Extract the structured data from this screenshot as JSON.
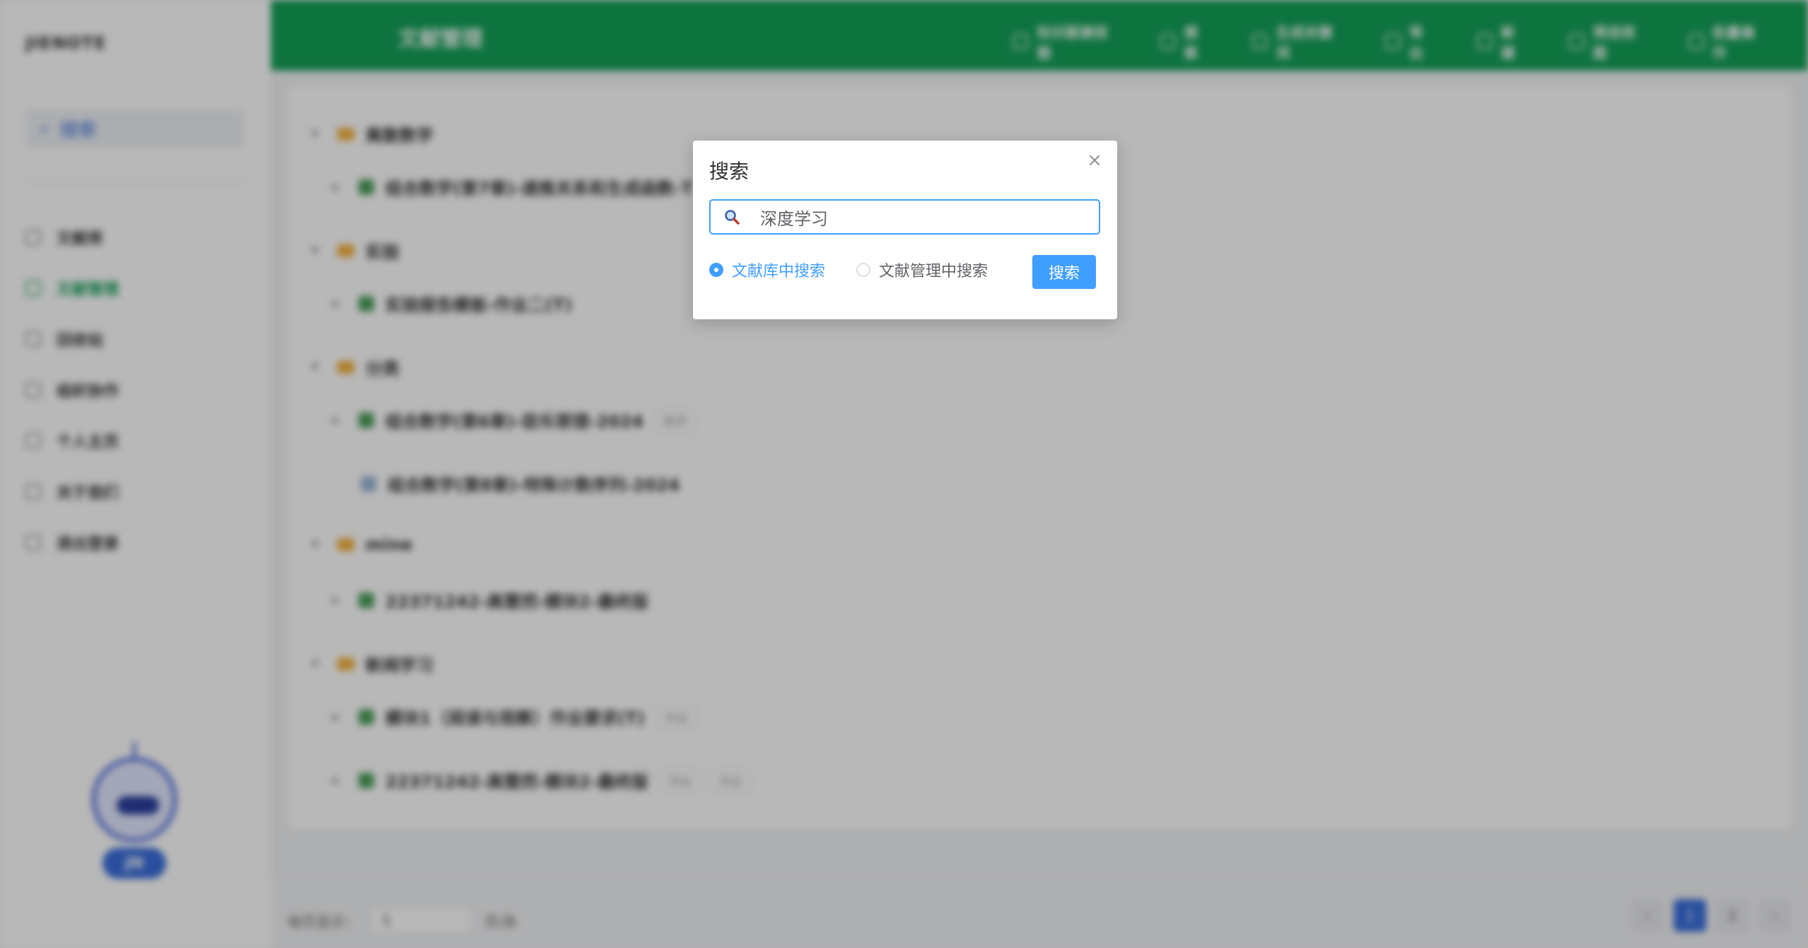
{
  "app": {
    "logo": "JIENOTE",
    "page_title": "文献管理"
  },
  "sidebar": {
    "search_label": "搜索",
    "items": [
      {
        "label": "文献库",
        "active": false
      },
      {
        "label": "文献管理",
        "active": true
      },
      {
        "label": "回收站",
        "active": false
      },
      {
        "label": "组织协作",
        "active": false
      },
      {
        "label": "个人主页",
        "active": false
      },
      {
        "label": "关于我们",
        "active": false
      },
      {
        "label": "退出登录",
        "active": false
      }
    ],
    "assistant_label": "JN"
  },
  "toolbar": {
    "actions": [
      "知识图谱视图",
      "搜索",
      "生成关键词",
      "导出",
      "新建",
      "筛选视图",
      "批量操作"
    ]
  },
  "tree": [
    {
      "type": "folder",
      "label": "离散数学"
    },
    {
      "type": "doc",
      "label": "组合数学(第7章)-递推关系和生成函数-T",
      "tags": []
    },
    {
      "type": "folder",
      "label": "实验"
    },
    {
      "type": "doc",
      "label": "实验报告模板-作业二(T)",
      "tags": []
    },
    {
      "type": "folder",
      "label": "分类"
    },
    {
      "type": "doc",
      "label": "组合数学(第6章)-容斥原理-2024",
      "tags": [
        "数学"
      ]
    },
    {
      "type": "file",
      "label": "组合数学(第8章)-特殊计数序列-2024",
      "tags": []
    },
    {
      "type": "folder",
      "label": "mine"
    },
    {
      "type": "doc",
      "label": "22371242-高慧然-模块2-最终版",
      "tags": []
    },
    {
      "type": "folder",
      "label": "新闻学习"
    },
    {
      "type": "doc",
      "label": "模块1（阅读与观察）作业要求(T)",
      "tags": [
        "作业"
      ]
    },
    {
      "type": "doc",
      "label": "22371242-高慧然-模块2-最终版",
      "tags": [
        "作业",
        "作业"
      ]
    }
  ],
  "pagination": {
    "page_size_label": "每页显示：",
    "page_size_value": "5",
    "page_size_suffix": "页/条",
    "pages": [
      "‹",
      "1",
      "2",
      "›"
    ],
    "current": "1"
  },
  "dialog": {
    "title": "搜索",
    "close_symbol": "×",
    "search_value": "深度学习",
    "options": [
      {
        "label": "文献库中搜索",
        "selected": true
      },
      {
        "label": "文献管理中搜索",
        "selected": false
      }
    ],
    "button_label": "搜索",
    "accent_color": "#409eff"
  }
}
